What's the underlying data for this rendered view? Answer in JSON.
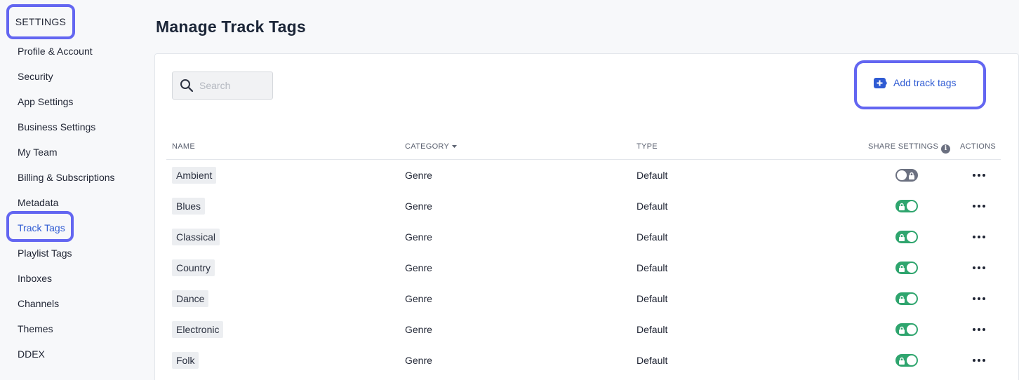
{
  "sidebar": {
    "header": "SETTINGS",
    "items": [
      {
        "label": "Profile & Account"
      },
      {
        "label": "Security"
      },
      {
        "label": "App Settings"
      },
      {
        "label": "Business Settings"
      },
      {
        "label": "My Team"
      },
      {
        "label": "Billing & Subscriptions"
      },
      {
        "label": "Metadata"
      },
      {
        "label": "Track Tags",
        "active": true
      },
      {
        "label": "Playlist Tags"
      },
      {
        "label": "Inboxes"
      },
      {
        "label": "Channels"
      },
      {
        "label": "Themes"
      },
      {
        "label": "DDEX"
      }
    ]
  },
  "page": {
    "title": "Manage Track Tags"
  },
  "search": {
    "placeholder": "Search",
    "value": "",
    "icon": "search-icon"
  },
  "actions": {
    "add_label": "Add track tags",
    "add_icon": "plus-square-icon"
  },
  "table": {
    "headers": {
      "name": "NAME",
      "category": "CATEGORY",
      "type": "TYPE",
      "share": "SHARE SETTINGS",
      "actions": "ACTIONS"
    },
    "rows": [
      {
        "name": "Ambient",
        "category": "Genre",
        "type": "Default",
        "shared": false
      },
      {
        "name": "Blues",
        "category": "Genre",
        "type": "Default",
        "shared": true
      },
      {
        "name": "Classical",
        "category": "Genre",
        "type": "Default",
        "shared": true
      },
      {
        "name": "Country",
        "category": "Genre",
        "type": "Default",
        "shared": true
      },
      {
        "name": "Dance",
        "category": "Genre",
        "type": "Default",
        "shared": true
      },
      {
        "name": "Electronic",
        "category": "Genre",
        "type": "Default",
        "shared": true
      },
      {
        "name": "Folk",
        "category": "Genre",
        "type": "Default",
        "shared": true
      }
    ]
  },
  "colors": {
    "accent": "#2f5bd3",
    "highlight_ring": "#6366f1",
    "toggle_on": "#2fa56e",
    "toggle_off": "#6b7080"
  }
}
